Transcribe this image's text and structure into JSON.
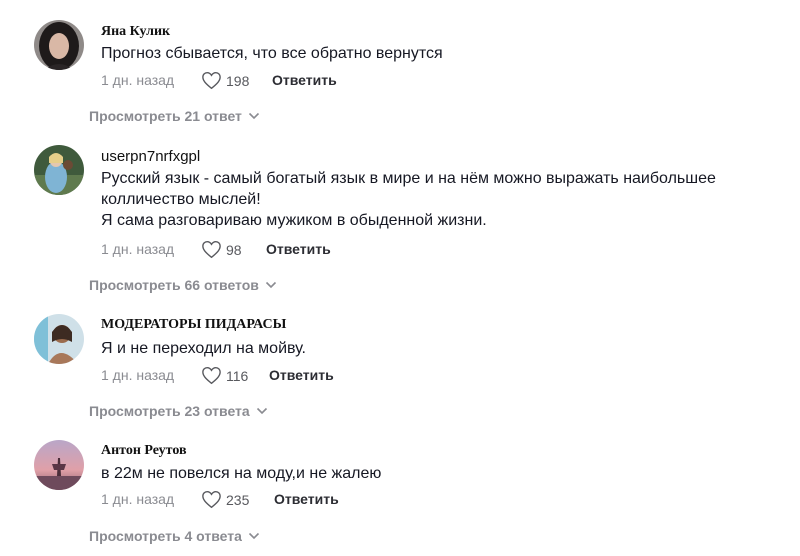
{
  "comments": [
    {
      "username": "Яна Кулик",
      "text": "Прогноз сбывается, что все обратно вернутся",
      "time": "1 дн. назад",
      "likes": "198",
      "reply": "Ответить",
      "view_replies": "Просмотреть 21 ответ"
    },
    {
      "username": "userpn7nrfxgpl",
      "text": "Русский язык - самый богатый язык в мире и на нём можно выражать наибольшее колличество мыслей!\nЯ сама разговариваю мужиком в обыденной жизни.",
      "time": "1 дн. назад",
      "likes": "98",
      "reply": "Ответить",
      "view_replies": "Просмотреть 66 ответов"
    },
    {
      "username": "МОДЕРАТОРЫ ПИДАРАСЫ",
      "text": "Я и не переходил на мойву.",
      "time": "1 дн. назад",
      "likes": "116",
      "reply": "Ответить",
      "view_replies": "Просмотреть 23 ответа"
    },
    {
      "username": "Антон Реутов",
      "text": "в 22м не повелся на моду,и не жалею",
      "time": "1 дн. назад",
      "likes": "235",
      "reply": "Ответить",
      "view_replies": "Просмотреть 4 ответа"
    }
  ],
  "icons": {
    "like": "heart-outline-icon",
    "expand": "chevron-down-icon"
  },
  "colors": {
    "text": "#161823",
    "muted": "#8a8b91",
    "reply": "#2c2d33"
  }
}
